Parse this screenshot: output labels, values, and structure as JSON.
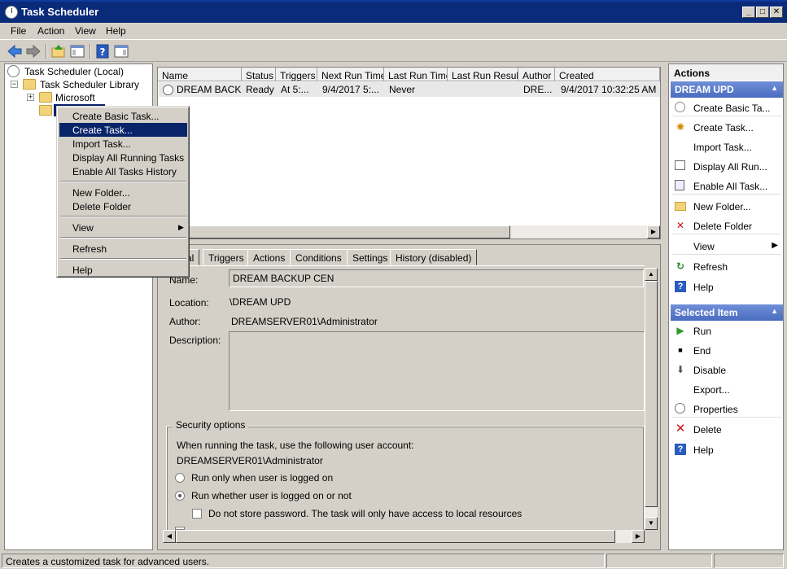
{
  "window": {
    "title": "Task Scheduler"
  },
  "menubar": {
    "items": [
      "File",
      "Action",
      "View",
      "Help"
    ]
  },
  "tree": {
    "root": "Task Scheduler (Local)",
    "library": "Task Scheduler Library",
    "microsoft": "Microsoft",
    "expander_plus": "+",
    "expander_minus": "−"
  },
  "task_list": {
    "columns": [
      "Name",
      "Status",
      "Triggers",
      "Next Run Time",
      "Last Run Time",
      "Last Run Result",
      "Author",
      "Created"
    ],
    "rows": [
      {
        "name": "DREAM BACK...",
        "status": "Ready",
        "triggers": "At 5:...",
        "next_run": "9/4/2017 5:...",
        "last_run": "Never",
        "last_result": "",
        "author": "DRE...",
        "created": "9/4/2017 10:32:25 AM"
      }
    ]
  },
  "details": {
    "tabs": [
      "General",
      "Triggers",
      "Actions",
      "Conditions",
      "Settings",
      "History (disabled)"
    ],
    "first_tab_visible": "ral",
    "name_label": "Name:",
    "name_value": "DREAM BACKUP CEN",
    "location_label": "Location:",
    "location_value": "\\DREAM UPD",
    "author_label": "Author:",
    "author_value": "DREAMSERVER01\\Administrator",
    "description_label": "Description:",
    "security_title": "Security options",
    "security_text": "When running the task, use the following user account:",
    "account": "DREAMSERVER01\\Administrator",
    "radio1": "Run only when user is logged on",
    "radio2": "Run whether user is logged on or not",
    "checkbox1": "Do not store password.  The task will only have access to local resources"
  },
  "context_menu": {
    "items": [
      "Create Basic Task...",
      "Create Task...",
      "Import Task...",
      "Display All Running Tasks",
      "Enable All Tasks History",
      "New Folder...",
      "Delete Folder",
      "View",
      "Refresh",
      "Help"
    ],
    "highlighted": "Create Task..."
  },
  "actions": {
    "header": "Actions",
    "section1_title": "DREAM UPD",
    "section1": [
      "Create Basic Ta...",
      "Create Task...",
      "Import Task...",
      "Display All Run...",
      "Enable All Task...",
      "New Folder...",
      "Delete Folder",
      "View",
      "Refresh",
      "Help"
    ],
    "section2_title": "Selected Item",
    "section2": [
      "Run",
      "End",
      "Disable",
      "Export...",
      "Properties",
      "Delete",
      "Help"
    ]
  },
  "statusbar": {
    "text": "Creates a customized task for advanced users."
  },
  "colors": {
    "title_bg": "#0a2a7a",
    "menu_highlight": "#0a246a",
    "section_header": "#4b6cc0"
  }
}
